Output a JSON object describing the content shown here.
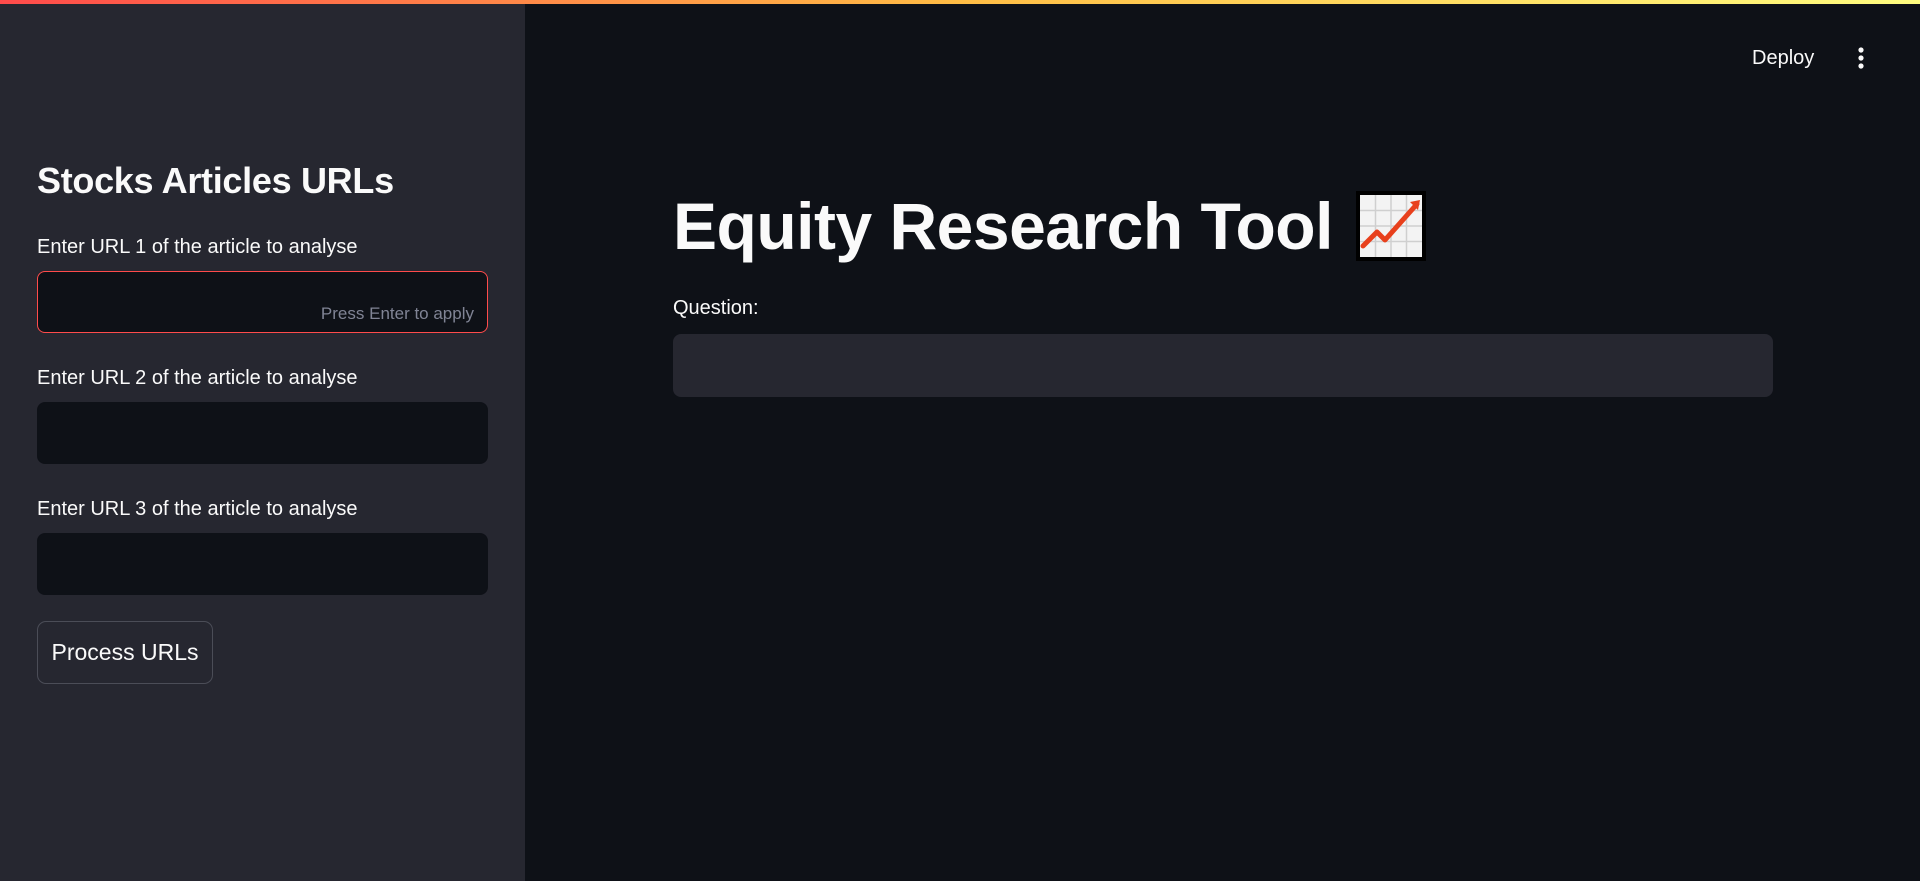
{
  "sidebar": {
    "title": "Stocks Articles URLs",
    "fields": [
      {
        "label": "Enter URL 1 of the article to analyse",
        "value": "",
        "hint": "Press Enter to apply"
      },
      {
        "label": "Enter URL 2 of the article to analyse",
        "value": ""
      },
      {
        "label": "Enter URL 3 of the article to analyse",
        "value": ""
      }
    ],
    "process_button": "Process URLs"
  },
  "header": {
    "deploy_label": "Deploy",
    "menu_icon": "vertical-ellipsis-icon"
  },
  "main": {
    "title": "Equity Research Tool",
    "title_icon": "chart-increasing-icon",
    "question_label": "Question:",
    "question_value": ""
  },
  "colors": {
    "accent": "#ff4b4b",
    "background": "#0e1117",
    "sidebar": "#262730",
    "text": "#fafafa"
  }
}
